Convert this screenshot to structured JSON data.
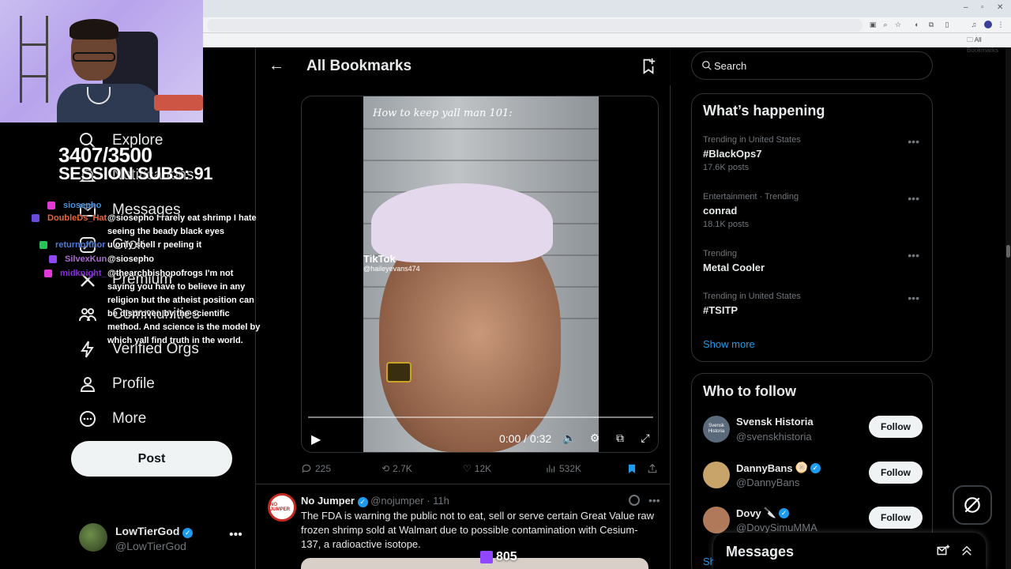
{
  "browser": {
    "bookmarks_label": "All Bookmarks"
  },
  "overlay": {
    "sub_counter_line1": "3407/3500",
    "sub_counter_line2": "SESSION SUBS: 91",
    "viewer_count": "805",
    "chat": [
      {
        "user": "siosepho",
        "msg": "",
        "color": "#4a90e2"
      },
      {
        "user": "DoubleDs_Hat",
        "msg": "@siosepho I rarely eat shrimp I hate seeing the beady black eyes",
        "color": "#e8643a"
      },
      {
        "user": "returnofthor",
        "msg": "u only shell r peeling it",
        "color": "#4a7de2"
      },
      {
        "user": "SilvexKun",
        "msg": "@siosepho",
        "color": "#b06ad9"
      },
      {
        "user": "midknight_",
        "msg": "@thearchbishopofrogs I'm not saying you have to believe in any religion but the atheist position can be disproven by the scientific method. And science is the model by which yall find truth in the world.",
        "color": "#8a2be2"
      }
    ]
  },
  "sidebar": {
    "items": [
      {
        "label": "Explore",
        "icon": "search-icon"
      },
      {
        "label": "Notifications",
        "icon": "bell-icon"
      },
      {
        "label": "Messages",
        "icon": "envelope-icon"
      },
      {
        "label": "Grok",
        "icon": "grok-icon"
      },
      {
        "label": "Premium",
        "icon": "x-logo-icon"
      },
      {
        "label": "Communities",
        "icon": "people-icon"
      },
      {
        "label": "Verified Orgs",
        "icon": "lightning-icon"
      },
      {
        "label": "Profile",
        "icon": "person-icon"
      },
      {
        "label": "More",
        "icon": "more-circle-icon"
      }
    ],
    "post_label": "Post",
    "account": {
      "name": "LowTierGod",
      "handle": "@LowTierGod"
    }
  },
  "main": {
    "title": "All Bookmarks",
    "video": {
      "caption": "How to keep yall man 101:",
      "watermark": "TikTok",
      "watermark_handle": "@haileyevans474",
      "time": "0:00 / 0:32",
      "progress": 0
    },
    "engagement": {
      "replies": "225",
      "reposts": "2.7K",
      "likes": "12K",
      "views": "532K"
    },
    "tweet2": {
      "author": "No Jumper",
      "handle": "@nojumper",
      "time": "· 11h",
      "avatar_text": "NO JUMPER",
      "text": "The FDA is warning the public not to eat, sell or serve certain Great Value raw frozen shrimp sold at Walmart due to possible contamination with Cesium-137, a radioactive isotope."
    }
  },
  "right": {
    "search_placeholder": "Search",
    "happening_title": "What’s happening",
    "trends": [
      {
        "context": "Trending in United States",
        "topic": "#BlackOps7",
        "count": "17.6K posts"
      },
      {
        "context": "Entertainment · Trending",
        "topic": "conrad",
        "count": "18.1K posts"
      },
      {
        "context": "Trending",
        "topic": "Metal Cooler",
        "count": ""
      },
      {
        "context": "Trending in United States",
        "topic": "#TSITP",
        "count": ""
      }
    ],
    "show_more": "Show more",
    "who_to_follow_title": "Who to follow",
    "follow": [
      {
        "name": "Svensk Historia",
        "handle": "@svenskhistoria",
        "verified": false,
        "emoji": "",
        "button": "Follow",
        "avatar_color": "#5a6a7a",
        "avatar_text": "Svensk Historia"
      },
      {
        "name": "DannyBans",
        "handle": "@DannyBans",
        "verified": true,
        "emoji": "🫓",
        "button": "Follow",
        "avatar_color": "#c9a46a",
        "avatar_text": ""
      },
      {
        "name": "Dovy",
        "handle": "@DovySimuMMA",
        "verified": true,
        "emoji": "🔪",
        "button": "Follow",
        "avatar_color": "#b07a5a",
        "avatar_text": ""
      }
    ],
    "messages_title": "Messages",
    "partial_link": "Sh"
  },
  "colors": {
    "accent": "#1d9bf0",
    "background": "#000000",
    "text": "#e7e9ea",
    "muted": "#71767b",
    "border": "#2f3336",
    "bookmark_active": "#1d9bf0"
  }
}
